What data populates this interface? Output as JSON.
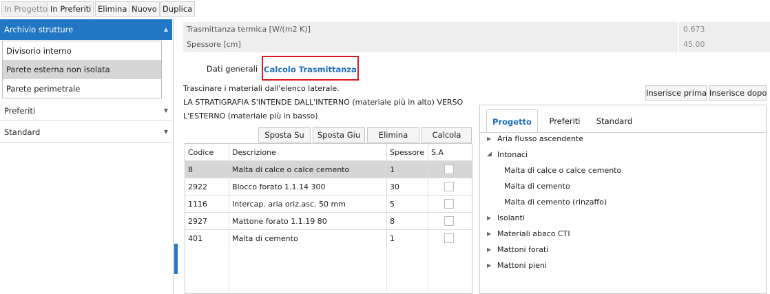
{
  "toolbar": {
    "in_progetto": "In Progetto",
    "in_preferiti": "In Preferiti",
    "elimina": "Elimina",
    "nuovo": "Nuovo",
    "duplica": "Duplica"
  },
  "sidebar": {
    "archivio_title": "Archivio strutture",
    "items": [
      "Divisorio interno",
      "Parete esterna non isolata",
      "Parete perimetrale"
    ],
    "preferiti": "Preferiti",
    "standard": "Standard"
  },
  "props": {
    "trasmittanza_label": "Trasmittanza termica [W/(m2 K)]",
    "trasmittanza_value": "0.673",
    "spessore_label": "Spessore [cm]",
    "spessore_value": "45.00"
  },
  "tabs": {
    "dati_generali": "Dati generali",
    "calcolo": "Calcolo Trasmittanza"
  },
  "instructions": {
    "line1": "Trascinare i materiali dall'elenco laterale.",
    "line2": "LA STRATIGRAFIA S'INTENDE DALL'INTERNO (materiale più in alto) VERSO",
    "line3": "L'ESTERNO (materiale più in basso)"
  },
  "buttons": {
    "sposta_su": "Sposta Su",
    "sposta_giu": "Sposta Giu",
    "elimina": "Elimina",
    "calcola": "Calcola",
    "inserisce_prima": "Inserisce prima",
    "inserisce_dopo": "Inserisce dopo"
  },
  "table": {
    "headers": {
      "codice": "Codice",
      "descrizione": "Descrizione",
      "spessore": "Spessore",
      "sa": "S.A"
    },
    "rows": [
      {
        "codice": "8",
        "descrizione": "Malta di calce o calce cemento",
        "spessore": "1"
      },
      {
        "codice": "2922",
        "descrizione": "Blocco forato 1.1.14 300",
        "spessore": "30"
      },
      {
        "codice": "1116",
        "descrizione": "Intercap. aria oriz.asc. 50 mm",
        "spessore": "5"
      },
      {
        "codice": "2927",
        "descrizione": "Mattone forato 1.1.19 80",
        "spessore": "8"
      },
      {
        "codice": "401",
        "descrizione": "Malta di cemento",
        "spessore": "1"
      }
    ]
  },
  "tree": {
    "tabs": {
      "progetto": "Progetto",
      "preferiti": "Preferiti",
      "standard": "Standard"
    },
    "nodes": [
      {
        "label": "Aria flusso ascendente"
      },
      {
        "label": "Intonaci"
      },
      {
        "label": "Malta di calce o calce cemento"
      },
      {
        "label": "Malta di cemento"
      },
      {
        "label": "Malta di cemento (rinzaffo)"
      },
      {
        "label": "Isolanti"
      },
      {
        "label": "Materiali abaco CTI"
      },
      {
        "label": "Mattoni forati"
      },
      {
        "label": "Mattoni pieni"
      }
    ]
  },
  "colors": {
    "accent": "#2277c4",
    "highlight_border": "#e0161b",
    "selected_row": "#d6d6d6"
  }
}
